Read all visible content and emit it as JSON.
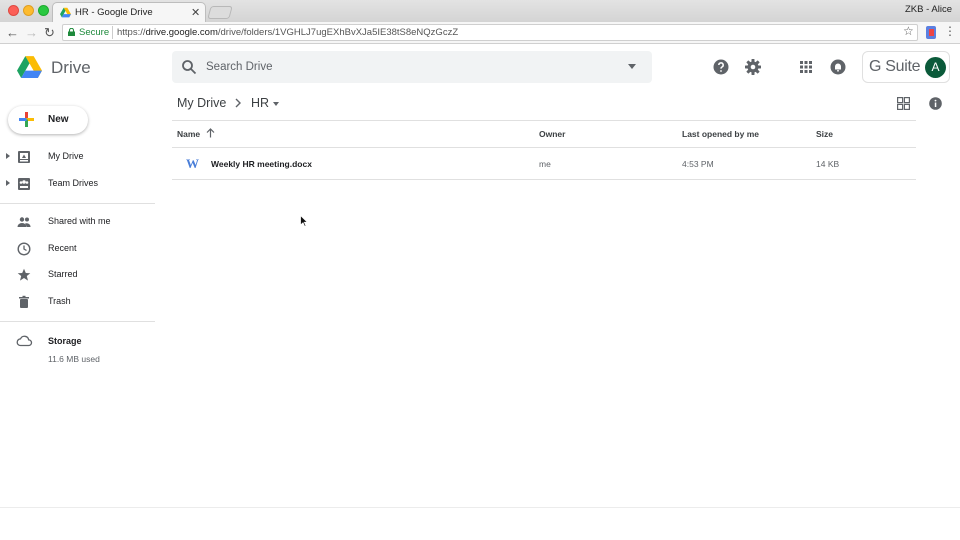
{
  "browser": {
    "tab_title": "HR - Google Drive",
    "profile": "ZKB - Alice",
    "secure_label": "Secure",
    "url_scheme": "https://",
    "url_host": "drive.google.com",
    "url_path": "/drive/folders/1VGHLJ7ugEXhBvXJa5IE38tS8eNQzGczZ"
  },
  "header": {
    "app_name": "Drive",
    "search_placeholder": "Search Drive",
    "gsuite_label": "G Suite",
    "avatar_letter": "A"
  },
  "sidebar": {
    "new_label": "New",
    "items": [
      {
        "label": "My Drive",
        "icon": "my-drive-icon"
      },
      {
        "label": "Team Drives",
        "icon": "team-drives-icon"
      },
      {
        "label": "Shared with me",
        "icon": "people-icon"
      },
      {
        "label": "Recent",
        "icon": "clock-icon"
      },
      {
        "label": "Starred",
        "icon": "star-icon"
      },
      {
        "label": "Trash",
        "icon": "trash-icon"
      }
    ],
    "storage_label": "Storage",
    "storage_used": "11.6 MB used"
  },
  "breadcrumb": {
    "root": "My Drive",
    "current": "HR"
  },
  "table": {
    "columns": [
      "Name",
      "Owner",
      "Last opened by me",
      "Size"
    ],
    "rows": [
      {
        "icon": "W",
        "name": "Weekly HR meeting.docx",
        "owner": "me",
        "last_opened": "4:53 PM",
        "size": "14 KB"
      }
    ]
  },
  "colors": {
    "word_blue": "#4a7ed8",
    "avatar_green": "#0b5a3a",
    "secure_green": "#1e8a3c"
  }
}
